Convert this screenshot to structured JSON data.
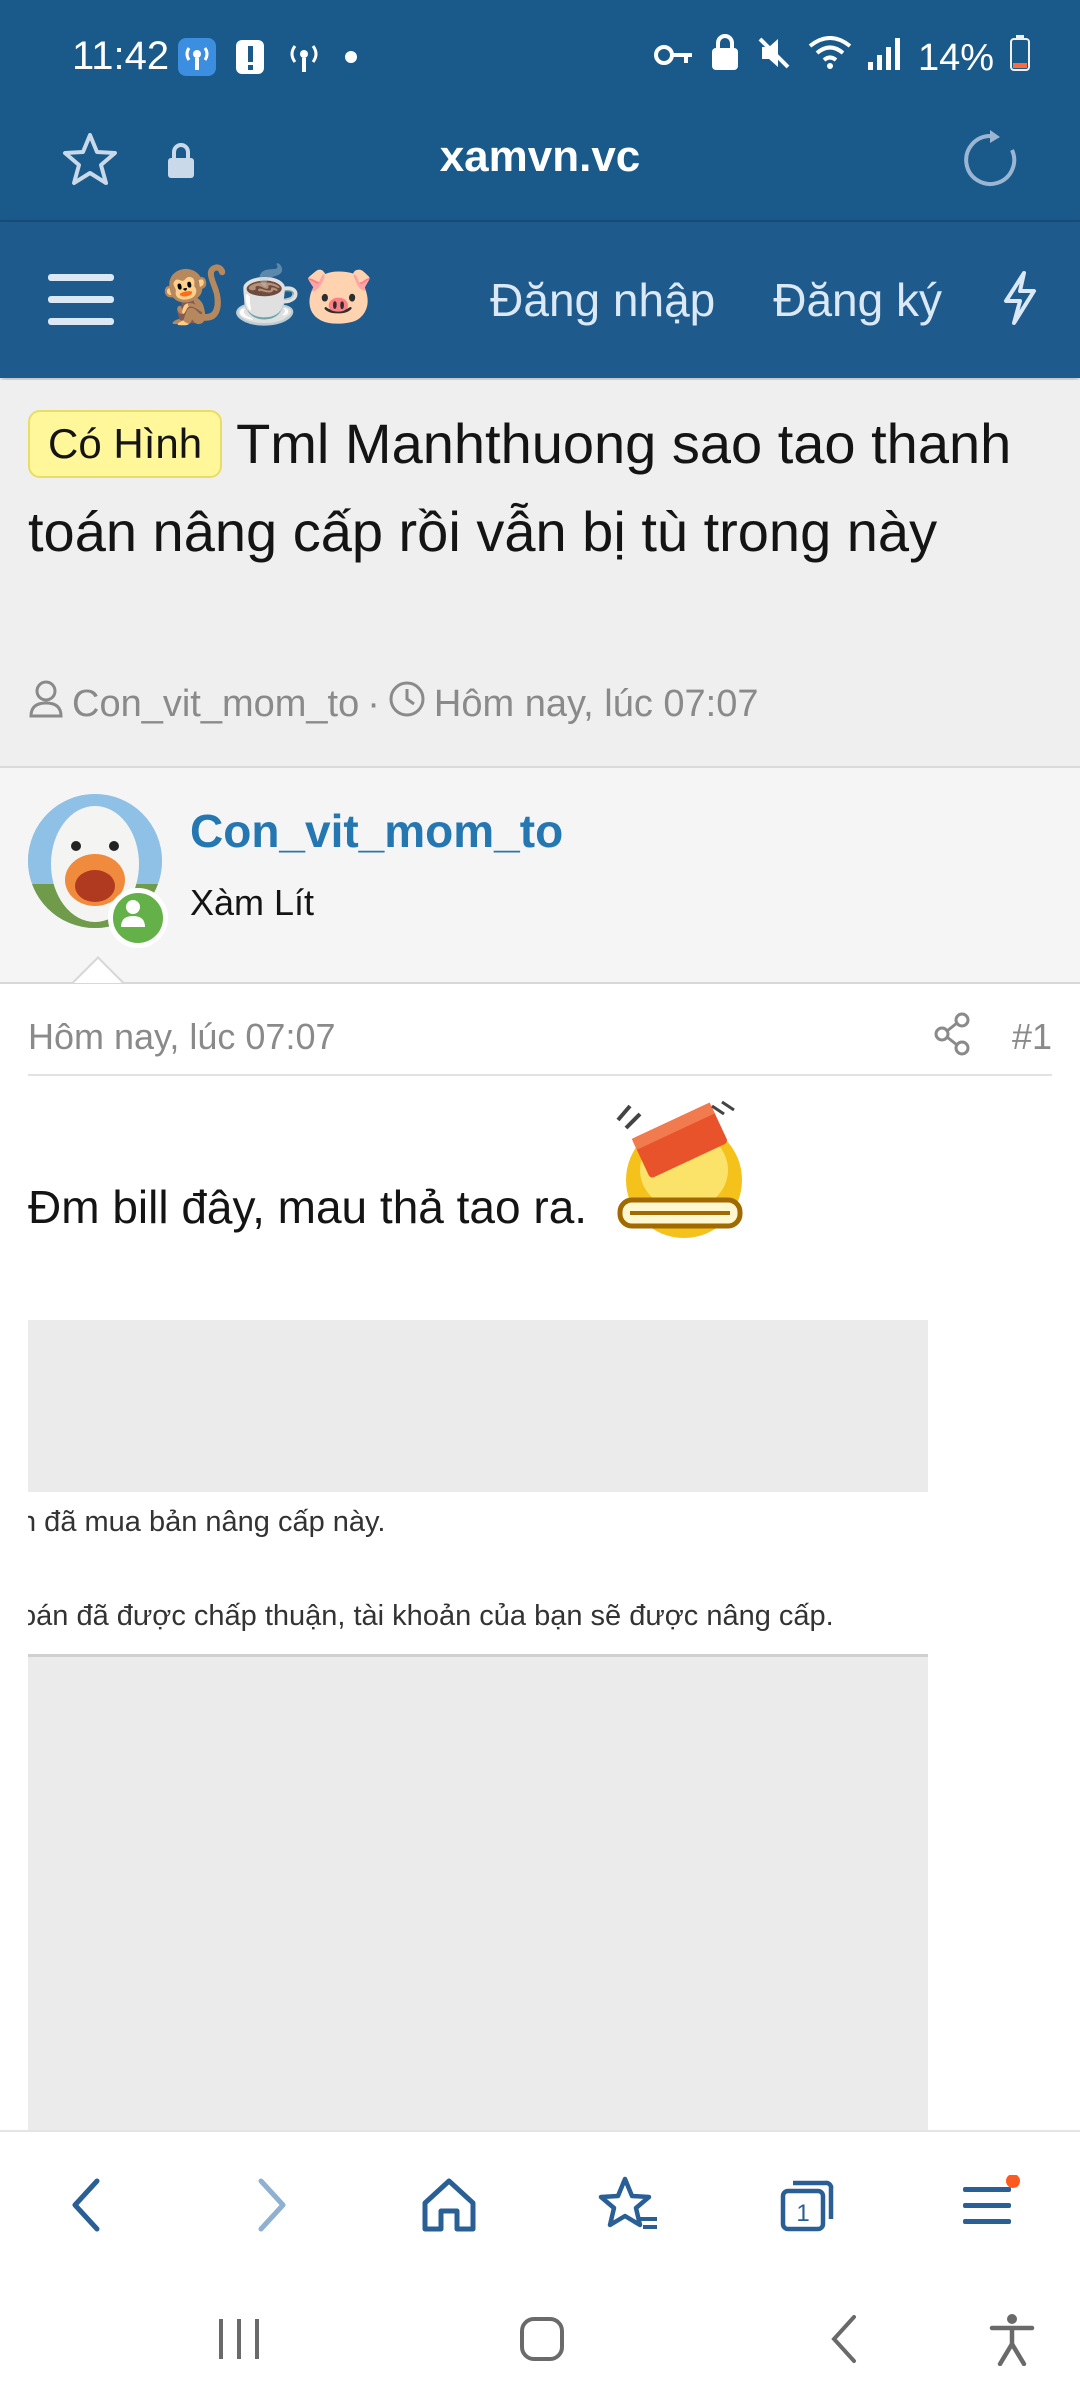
{
  "status_bar": {
    "time": "11:42",
    "battery": "14%"
  },
  "browser": {
    "url": "xamvn.vc"
  },
  "nav": {
    "login_label": "Đăng nhập",
    "register_label": "Đăng ký",
    "emojis": [
      "🐒",
      "☕",
      "🐷"
    ]
  },
  "thread": {
    "badge": "Có Hình",
    "title": "Tml Manhthuong sao tao thanh toán nâng cấp rồi vẫn bị tù trong này",
    "author": "Con_vit_mom_to",
    "sep": "·",
    "date": "Hôm nay, lúc 07:07"
  },
  "post": {
    "username": "Con_vit_mom_to",
    "user_title": "Xàm Lít",
    "date": "Hôm nay, lúc 07:07",
    "number": "#1",
    "text": "Đm bill đây, mau thả tao ra.",
    "screenshot_line1": "n đã mua bản nâng cấp này.",
    "screenshot_line2": "oán đã được chấp thuận, tài khoản của bạn sẽ được nâng cấp."
  },
  "colors": {
    "header_bg": "#1a5a8a",
    "accent_link": "#2577b1",
    "badge_bg": "#fff799",
    "online": "#63b148"
  }
}
